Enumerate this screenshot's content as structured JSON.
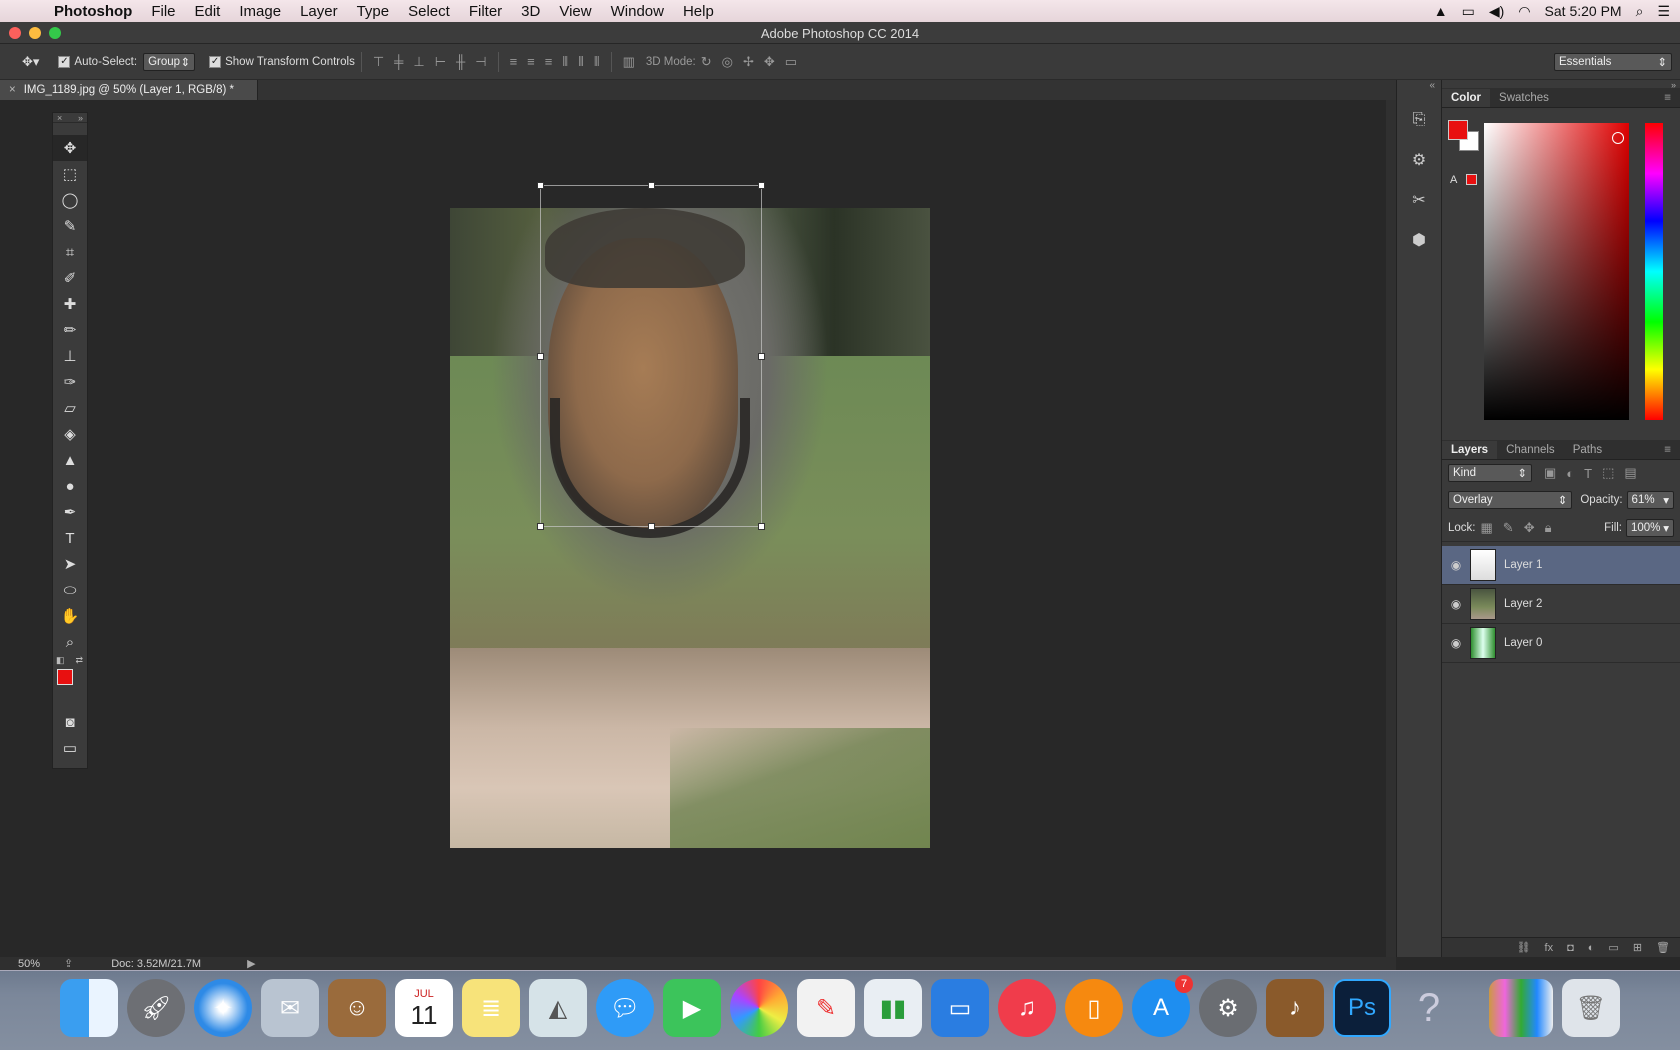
{
  "menubar": {
    "app": "Photoshop",
    "items": [
      "File",
      "Edit",
      "Image",
      "Layer",
      "Type",
      "Select",
      "Filter",
      "3D",
      "View",
      "Window",
      "Help"
    ],
    "clock": "Sat 5:20 PM"
  },
  "window": {
    "title": "Adobe Photoshop CC 2014"
  },
  "options": {
    "auto_select_label": "Auto-Select:",
    "auto_select_value": "Group",
    "show_transform_label": "Show Transform Controls",
    "mode3d_label": "3D Mode:",
    "workspace": "Essentials"
  },
  "document": {
    "tab_title": "IMG_1189.jpg @ 50% (Layer 1, RGB/8) *"
  },
  "status": {
    "zoom": "50%",
    "doc": "Doc: 3.52M/21.7M"
  },
  "color_panel": {
    "tabs": [
      "Color",
      "Swatches"
    ],
    "foreground": "#e81010",
    "background": "#ffffff",
    "gamut_label": "A"
  },
  "layers_panel": {
    "tabs": [
      "Layers",
      "Channels",
      "Paths"
    ],
    "filter": "Kind",
    "blend_mode": "Overlay",
    "opacity_label": "Opacity:",
    "opacity": "61%",
    "lock_label": "Lock:",
    "fill_label": "Fill:",
    "fill": "100%",
    "layers": [
      {
        "name": "Layer 1",
        "active": true
      },
      {
        "name": "Layer 2",
        "active": false
      },
      {
        "name": "Layer 0",
        "active": false
      }
    ]
  },
  "dock": {
    "app_store_badge": "7",
    "calendar_month": "JUL",
    "calendar_day": "11"
  }
}
